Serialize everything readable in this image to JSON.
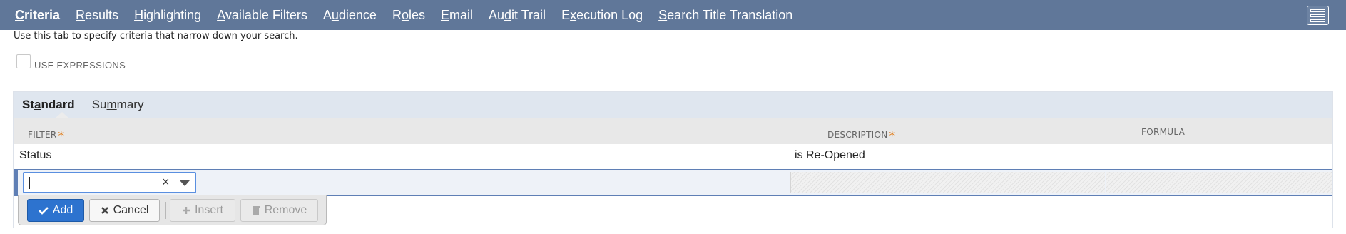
{
  "tabs": [
    {
      "pre": "",
      "acc": "C",
      "post": "riteria"
    },
    {
      "pre": "",
      "acc": "R",
      "post": "esults"
    },
    {
      "pre": "",
      "acc": "H",
      "post": "ighlighting"
    },
    {
      "pre": "",
      "acc": "A",
      "post": "vailable Filters"
    },
    {
      "pre": "A",
      "acc": "u",
      "post": "dience"
    },
    {
      "pre": "R",
      "acc": "o",
      "post": "les"
    },
    {
      "pre": "",
      "acc": "E",
      "post": "mail"
    },
    {
      "pre": "Au",
      "acc": "d",
      "post": "it Trail"
    },
    {
      "pre": "E",
      "acc": "x",
      "post": "ecution Log"
    },
    {
      "pre": "",
      "acc": "S",
      "post": "earch Title Translation"
    }
  ],
  "menu_icon": "hamburger-menu-icon",
  "help_text": "Use this tab to specify criteria that narrow down your search.",
  "use_expressions": {
    "label": "USE EXPRESSIONS",
    "checked": false
  },
  "subtabs": [
    {
      "pre": "St",
      "acc": "a",
      "post": "ndard"
    },
    {
      "pre": "Su",
      "acc": "m",
      "post": "mary"
    }
  ],
  "columns": {
    "filter": "FILTER",
    "description": "DESCRIPTION",
    "formula": "FORMULA",
    "required_mark": "*"
  },
  "row": {
    "filter": "Status",
    "description": "is Re-Opened",
    "formula": ""
  },
  "edit": {
    "filter_value": "",
    "clear_icon": "×"
  },
  "buttons": {
    "add": "Add",
    "cancel": "Cancel",
    "insert": "Insert",
    "remove": "Remove"
  },
  "colors": {
    "topbar": "#607799",
    "subtabs": "#dfe6ef",
    "primary_button": "#2d73cf",
    "required": "#e07b17",
    "focus": "#5a8fe0"
  }
}
